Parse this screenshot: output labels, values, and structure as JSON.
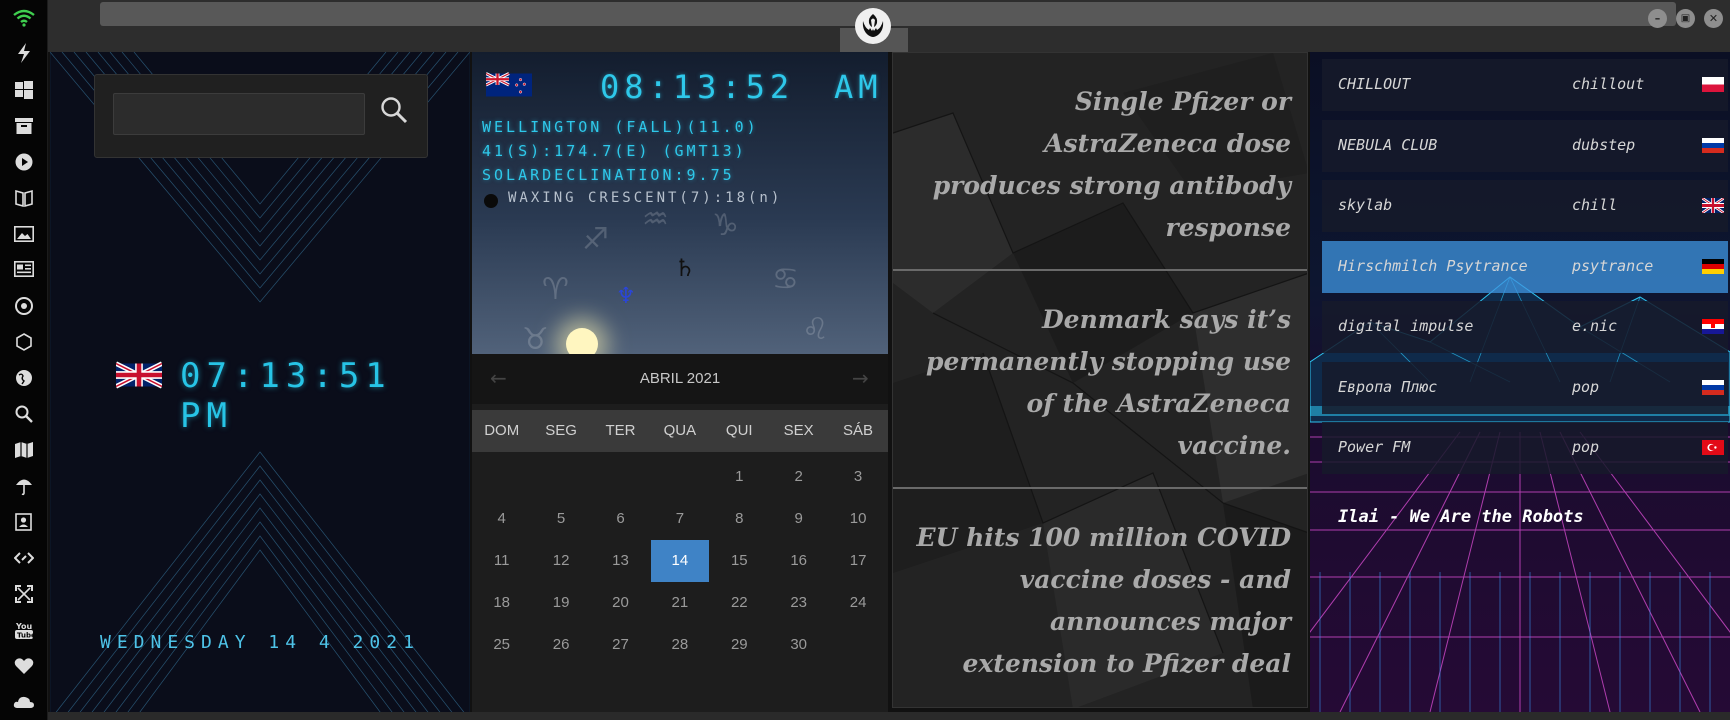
{
  "sidebar": {
    "icons": [
      "wifi-icon",
      "lightning-icon",
      "windows-icon",
      "archive-icon",
      "play-icon",
      "book-icon",
      "image-icon",
      "newspaper-icon",
      "aperture-icon",
      "hexagon-icon",
      "globe-icon",
      "search-icon",
      "map-icon",
      "umbrella-icon",
      "contacts-icon",
      "code-icon",
      "expand-icon",
      "youtube-icon",
      "heart-icon",
      "cloud-icon"
    ]
  },
  "window": {
    "minimize_label": "–",
    "maximize_label": "▣",
    "close_label": "✕"
  },
  "clock": {
    "search_placeholder": "",
    "uk_time": "07:13:51 PM",
    "date_line": "WEDNESDAY 14 4 2021"
  },
  "astro": {
    "nz_time": "08:13:52",
    "nz_ampm": "AM",
    "location": "WELLINGTON (FALL)(11.0)",
    "coords": "41(S):174.7(E) (GMT13)",
    "solar": "SOLARDECLINATION:9.75",
    "moon": "WAXING CRESCENT(7):18(n)"
  },
  "calendar": {
    "month": "ABRIL 2021",
    "prev_label": "←",
    "next_label": "→",
    "weekdays": [
      "DOM",
      "SEG",
      "TER",
      "QUA",
      "QUI",
      "SEX",
      "SÁB"
    ],
    "first_weekday": 4,
    "days_in_month": 30,
    "today": 14
  },
  "news": {
    "items": [
      "Single Pfizer or AstraZeneca dose produces strong antibody response",
      "Denmark says it’s permanently stopping use of the AstraZeneca vaccine.",
      "EU hits 100 million COVID vaccine doses - and announces major extension to Pfizer deal"
    ]
  },
  "radio": {
    "stations": [
      {
        "name": "CHILLOUT",
        "genre": "chillout",
        "flag": "poland"
      },
      {
        "name": "NEBULA CLUB",
        "genre": "dubstep",
        "flag": "russia"
      },
      {
        "name": "skylab",
        "genre": "chill",
        "flag": "uk"
      },
      {
        "name": "Hirschmilch Psytrance",
        "genre": "psytrance",
        "flag": "germany"
      },
      {
        "name": "digital impulse",
        "genre": "e.nic",
        "flag": "croatia"
      },
      {
        "name": "Европа Плюс",
        "genre": "pop",
        "flag": "russia"
      },
      {
        "name": "Power FM",
        "genre": "pop",
        "flag": "turkey"
      }
    ],
    "active_index": 3,
    "now_playing": "Ilai - We Are the Robots"
  },
  "colors": {
    "lcd_cyan": "#27c4e6",
    "today_blue": "#3f83c6",
    "active_station": "#3f96e1"
  }
}
